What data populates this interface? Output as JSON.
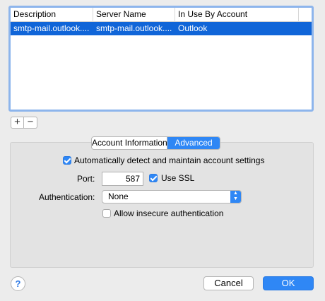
{
  "table": {
    "columns": [
      "Description",
      "Server Name",
      "In Use By Account"
    ],
    "rows": [
      {
        "description": "smtp-mail.outlook....",
        "server": "smtp-mail.outlook....",
        "account": "Outlook"
      }
    ]
  },
  "controls": {
    "plus": "+",
    "minus": "−"
  },
  "tabs": {
    "account_info": "Account Information",
    "advanced": "Advanced",
    "selected": "Advanced"
  },
  "advanced": {
    "auto_detect_label": "Automatically detect and maintain account settings",
    "auto_detect_checked": true,
    "port_label": "Port:",
    "port_value": "587",
    "use_ssl_label": "Use SSL",
    "use_ssl_checked": true,
    "auth_label": "Authentication:",
    "auth_value": "None",
    "insecure_label": "Allow insecure authentication",
    "insecure_checked": false
  },
  "buttons": {
    "help": "?",
    "cancel": "Cancel",
    "ok": "OK"
  },
  "colors": {
    "accent": "#2f87f5",
    "selection": "#1065d8",
    "focus_ring": "#8db5ec"
  },
  "icons": {
    "select": "up-down-chevron-icon",
    "checkmark": "checkmark-icon"
  }
}
